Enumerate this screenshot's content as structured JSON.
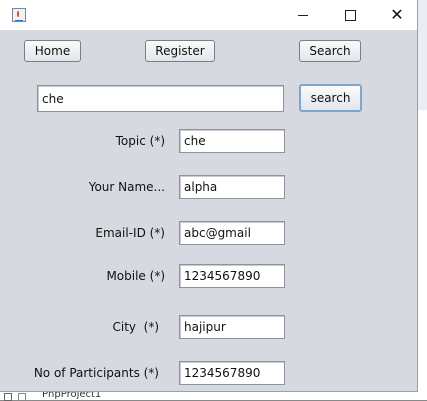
{
  "window": {
    "title": "",
    "controls": {
      "minimize": "minimize",
      "maximize": "maximize",
      "close": "close"
    }
  },
  "nav": {
    "home": "Home",
    "register": "Register",
    "search": "Search"
  },
  "search_bar": {
    "value": "che",
    "button": "search"
  },
  "form": {
    "fields": [
      {
        "label": "Topic (*)",
        "value": "che"
      },
      {
        "label": "Your Name...",
        "value": "alpha"
      },
      {
        "label": "Email-ID (*)",
        "value": "abc@gmail"
      },
      {
        "label": "Mobile (*)",
        "value": "1234567890"
      },
      {
        "label": "City  (*)",
        "value": "hajipur"
      },
      {
        "label": "No of Participants (*)",
        "value": "1234567890"
      }
    ]
  },
  "background": {
    "bottom_text": "PhpProject1"
  }
}
